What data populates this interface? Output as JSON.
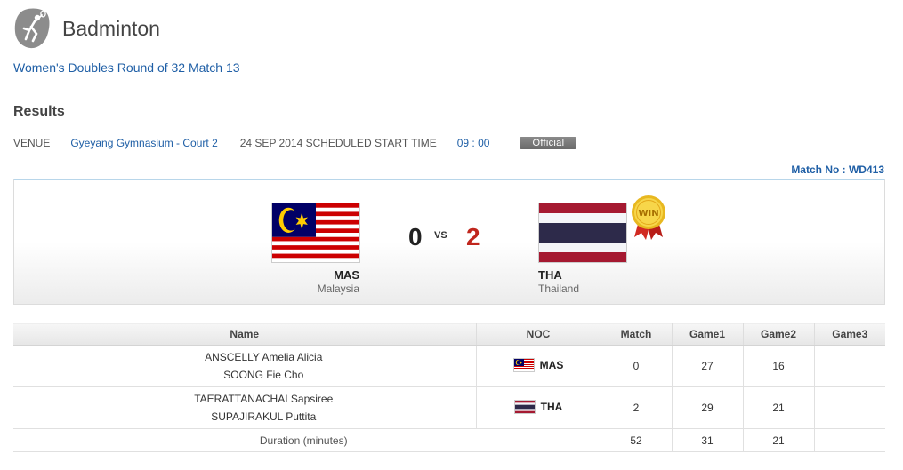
{
  "header": {
    "sport": "Badminton",
    "icon": "badminton-player-icon"
  },
  "event": {
    "name": "Women's Doubles Round of 32 Match 13"
  },
  "results_title": "Results",
  "info": {
    "venue_label": "VENUE",
    "venue": "Gyeyang Gymnasium - Court 2",
    "date_label": "24 SEP 2014 SCHEDULED START TIME",
    "time": "09 : 00",
    "status": "Official"
  },
  "match_no": "Match No : WD413",
  "scoreboard": {
    "left": {
      "code": "MAS",
      "country": "Malaysia",
      "score": "0"
    },
    "vs": "VS",
    "right": {
      "code": "THA",
      "country": "Thailand",
      "score": "2"
    },
    "win_badge": "WIN"
  },
  "table": {
    "headers": {
      "name": "Name",
      "noc": "NOC",
      "match": "Match",
      "game1": "Game1",
      "game2": "Game2",
      "game3": "Game3"
    },
    "rows": [
      {
        "player1": "ANSCELLY Amelia Alicia",
        "player2": "SOONG Fie Cho",
        "noc": "MAS",
        "match": "0",
        "game1": "27",
        "game2": "16",
        "game3": ""
      },
      {
        "player1": "TAERATTANACHAI Sapsiree",
        "player2": "SUPAJIRAKUL Puttita",
        "noc": "THA",
        "match": "2",
        "game1": "29",
        "game2": "21",
        "game3": ""
      }
    ],
    "duration": {
      "label": "Duration (minutes)",
      "match": "52",
      "game1": "31",
      "game2": "21",
      "game3": ""
    }
  },
  "colors": {
    "link": "#1f5fa6",
    "winner_score": "#c0261d",
    "official_badge": "#777777"
  }
}
